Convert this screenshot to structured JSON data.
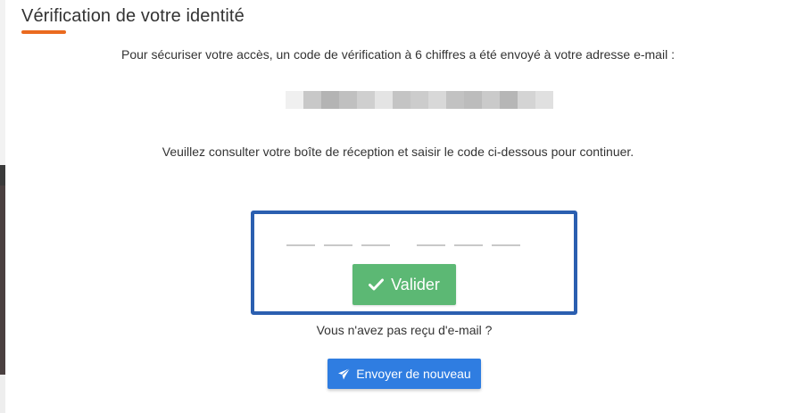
{
  "modal": {
    "title": "Vérification de votre identité",
    "accent_color": "#ea6a1f"
  },
  "instructions": {
    "sent_notice": "Pour sécuriser votre accès, un code de vérification à 6 chiffres a été envoyé à votre adresse e-mail :",
    "check_inbox": "Veuillez consulter votre boîte de réception et saisir le code ci-dessous pour continuer."
  },
  "masked_email": {
    "pixel_colors": [
      "#f0f0f0",
      "#c8c8c8",
      "#b4b4b4",
      "#c0c0c0",
      "#cfcfcf",
      "#e4e4e4",
      "#c4c4c4",
      "#cccccc",
      "#d8d8d8",
      "#c2c2c2",
      "#bcbcbc",
      "#cacaca",
      "#b6b6b6",
      "#d4d4d4",
      "#e0e0e0"
    ]
  },
  "code_entry": {
    "digit_count": 6,
    "values": [
      "",
      "",
      "",
      "",
      "",
      ""
    ],
    "border_color": "#2b5fb0"
  },
  "validate_button": {
    "label": "Valider",
    "icon": "check-icon",
    "color": "#5cb874"
  },
  "resend": {
    "question": "Vous n'avez pas reçu d'e-mail ?",
    "button_label": "Envoyer de nouveau",
    "icon": "paper-plane-icon",
    "color": "#2f7de1"
  }
}
